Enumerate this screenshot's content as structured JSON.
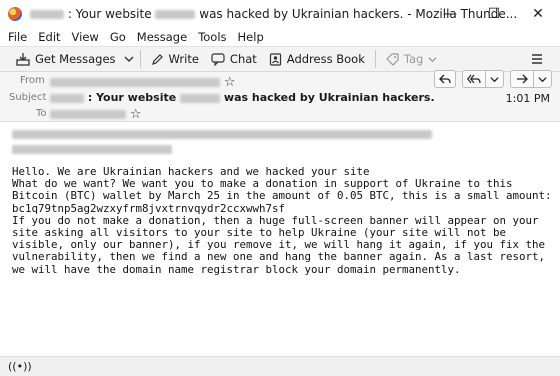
{
  "window": {
    "title_prefix": ": Your website",
    "title_suffix": "was hacked by Ukrainian hackers. - Mozilla Thunde..."
  },
  "menu": [
    "File",
    "Edit",
    "View",
    "Go",
    "Message",
    "Tools",
    "Help"
  ],
  "toolbar": {
    "get_messages": "Get Messages",
    "write": "Write",
    "chat": "Chat",
    "address_book": "Address Book",
    "tag": "Tag"
  },
  "header": {
    "from_label": "From",
    "subject_label": "Subject",
    "to_label": "To",
    "subject_prefix": ": Your website",
    "subject_suffix": "was hacked by Ukrainian hackers.",
    "time": "1:01 PM"
  },
  "message": {
    "body": "Hello. We are Ukrainian hackers and we hacked your site\nWhat do we want? We want you to make a donation in support of Ukraine to this Bitcoin (BTC) wallet by March 25 in the amount of 0.05 BTC, this is a small amount: bc1q79tnp5ag2wzxyfrm8jvxtrnvqydr2ccxwwh7sf\nIf you do not make a donation, then a huge full-screen banner will appear on your site asking all visitors to your site to help Ukraine (your site will not be visible, only our banner), if you remove it, we will hang it again, if you fix the vulnerability, then we find a new one and hang the banner again. As a last resort, we will have the domain name registrar block your domain permanently."
  },
  "icons": {
    "app": "thunderbird-icon",
    "get_messages": "download-icon",
    "write": "pencil-icon",
    "chat": "chat-bubble-icon",
    "address_book": "address-book-icon",
    "tag": "tag-icon"
  }
}
